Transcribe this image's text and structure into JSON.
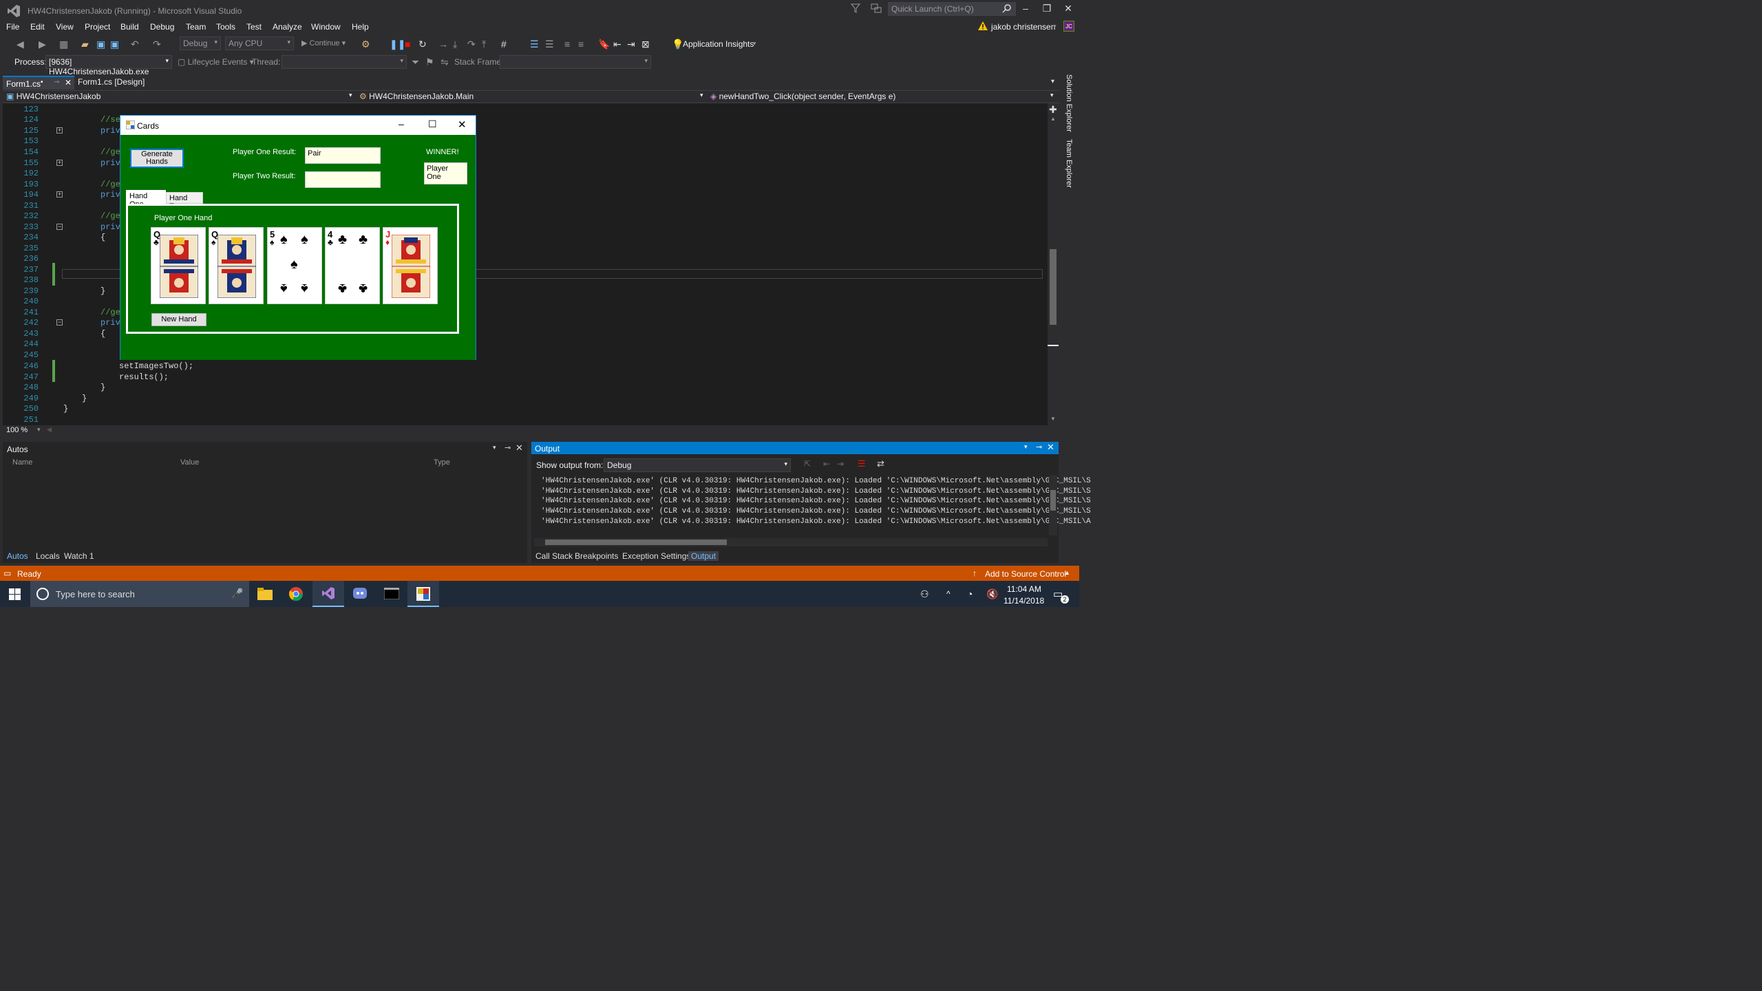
{
  "titlebar": {
    "title": "HW4ChristensenJakob (Running) - Microsoft Visual Studio",
    "quick_launch": "Quick Launch (Ctrl+Q)"
  },
  "menu": [
    "File",
    "Edit",
    "View",
    "Project",
    "Build",
    "Debug",
    "Team",
    "Tools",
    "Test",
    "Analyze",
    "Window",
    "Help"
  ],
  "user": {
    "name": "jakob christensen",
    "initials": "JC"
  },
  "toolbar": {
    "config": "Debug",
    "platform": "Any CPU",
    "continue": "Continue",
    "app_insights": "Application Insights"
  },
  "debugbar": {
    "process_label": "Process:",
    "process_value": "[9636] HW4ChristensenJakob.exe",
    "lifecycle": "Lifecycle Events",
    "thread_label": "Thread:",
    "stack_label": "Stack Frame:"
  },
  "tabs": {
    "tab1": "Form1.cs",
    "tab2": "Form1.cs [Design]"
  },
  "nav": {
    "project": "HW4ChristensenJakob",
    "class": "HW4ChristensenJakob.Main",
    "member": "newHandTwo_Click(object sender, EventArgs e)"
  },
  "side": {
    "solution": "Solution Explorer",
    "team": "Team Explorer"
  },
  "code": {
    "lines": [
      "123",
      "124",
      "125",
      "153",
      "154",
      "155",
      "192",
      "193",
      "194",
      "231",
      "232",
      "233",
      "234",
      "235",
      "236",
      "237",
      "238",
      "239",
      "240",
      "241",
      "242",
      "243",
      "244",
      "245",
      "246",
      "247",
      "248",
      "249",
      "250",
      "251"
    ],
    "c124": "//se",
    "c125": "priv",
    "c154": "//ge",
    "c155": "priv",
    "c193": "//ge",
    "c194": "priv",
    "c232": "//ge",
    "c233": "priv",
    "c234": "{",
    "c239": "}",
    "c241": "//ge",
    "c242": "priv",
    "c243": "{",
    "c246": "setImagesTwo();",
    "c247": "results();",
    "c248": "}",
    "c249": "}",
    "c250": "}"
  },
  "zoom": "100 %",
  "cards_form": {
    "title": "Cards",
    "generate_button": "Generate Hands",
    "p1_label": "Player One Result:",
    "p1_value": "Pair",
    "p2_label": "Player Two Result:",
    "p2_value": "",
    "winner_label": "WINNER!",
    "winner_value": "Player One",
    "tab_one": "Hand One",
    "tab_two": "Hand Two",
    "hand_label": "Player One Hand",
    "new_hand_button": "New Hand",
    "cards": [
      {
        "rank": "Q",
        "suit": "♣",
        "color": "#000"
      },
      {
        "rank": "Q",
        "suit": "♠",
        "color": "#000"
      },
      {
        "rank": "5",
        "suit": "♠",
        "color": "#000"
      },
      {
        "rank": "4",
        "suit": "♣",
        "color": "#000"
      },
      {
        "rank": "J",
        "suit": "♦",
        "color": "#e31c1c"
      }
    ]
  },
  "autos": {
    "title": "Autos",
    "col_name": "Name",
    "col_value": "Value",
    "col_type": "Type",
    "tabs": [
      "Autos",
      "Locals",
      "Watch 1"
    ]
  },
  "output": {
    "title": "Output",
    "show_from": "Show output from:",
    "source": "Debug",
    "lines": [
      "'HW4ChristensenJakob.exe' (CLR v4.0.30319: HW4ChristensenJakob.exe): Loaded 'C:\\WINDOWS\\Microsoft.Net\\assembly\\GAC_MSIL\\S",
      "'HW4ChristensenJakob.exe' (CLR v4.0.30319: HW4ChristensenJakob.exe): Loaded 'C:\\WINDOWS\\Microsoft.Net\\assembly\\GAC_MSIL\\S",
      "'HW4ChristensenJakob.exe' (CLR v4.0.30319: HW4ChristensenJakob.exe): Loaded 'C:\\WINDOWS\\Microsoft.Net\\assembly\\GAC_MSIL\\S",
      "'HW4ChristensenJakob.exe' (CLR v4.0.30319: HW4ChristensenJakob.exe): Loaded 'C:\\WINDOWS\\Microsoft.Net\\assembly\\GAC_MSIL\\S",
      "'HW4ChristensenJakob.exe' (CLR v4.0.30319: HW4ChristensenJakob.exe): Loaded 'C:\\WINDOWS\\Microsoft.Net\\assembly\\GAC_MSIL\\A"
    ],
    "tabs": [
      "Call Stack",
      "Breakpoints",
      "Exception Settings",
      "Output"
    ]
  },
  "status": {
    "text": "Ready",
    "source_control": "Add to Source Control"
  },
  "taskbar": {
    "search": "Type here to search",
    "time": "11:04 AM",
    "date": "11/14/2018",
    "notif": "2"
  }
}
